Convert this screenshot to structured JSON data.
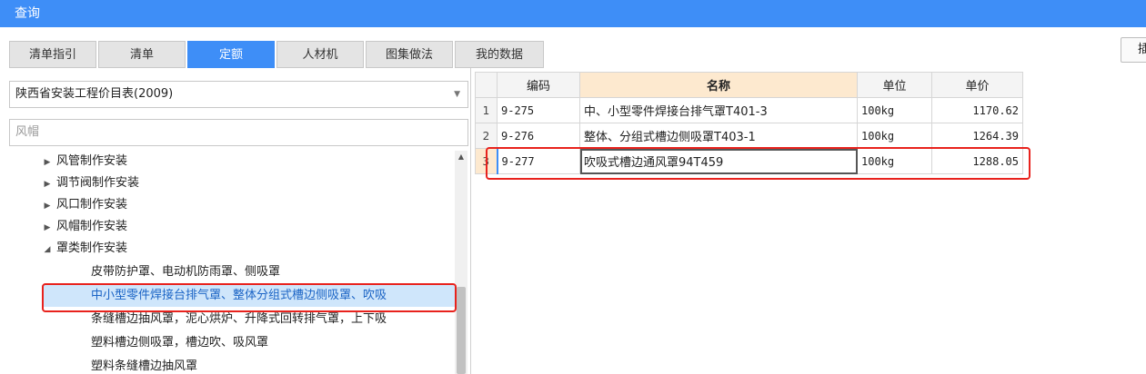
{
  "window": {
    "title": "查询"
  },
  "tabs": [
    {
      "label": "清单指引",
      "active": false
    },
    {
      "label": "清单",
      "active": false
    },
    {
      "label": "定额",
      "active": true
    },
    {
      "label": "人材机",
      "active": false
    },
    {
      "label": "图集做法",
      "active": false
    },
    {
      "label": "我的数据",
      "active": false
    }
  ],
  "right_button": {
    "label": "插"
  },
  "library_select": {
    "value": "陕西省安装工程价目表(2009)"
  },
  "search": {
    "value": "风帽"
  },
  "tree": [
    {
      "label": "风管制作安装",
      "expanded": false
    },
    {
      "label": "调节阀制作安装",
      "expanded": false
    },
    {
      "label": "风口制作安装",
      "expanded": false
    },
    {
      "label": "风帽制作安装",
      "expanded": false
    },
    {
      "label": "罩类制作安装",
      "expanded": true
    },
    {
      "label": "皮带防护罩、电动机防雨罩、侧吸罩"
    },
    {
      "label": "中小型零件焊接台排气罩、整体分组式槽边侧吸罩、吹吸",
      "selected": true
    },
    {
      "label": "条缝槽边抽风罩，泥心烘炉、升降式回转排气罩，上下吸"
    },
    {
      "label": "塑料槽边侧吸罩，槽边吹、吸风罩"
    },
    {
      "label": "塑料条缝槽边抽风罩"
    }
  ],
  "grid": {
    "headers": {
      "code": "编码",
      "name": "名称",
      "unit": "单位",
      "price": "单价"
    },
    "rows": [
      {
        "num": "1",
        "code": "9-275",
        "name": "中、小型零件焊接台排气罩T401-3",
        "unit": "100kg",
        "price": "1170.62"
      },
      {
        "num": "2",
        "code": "9-276",
        "name": "整体、分组式槽边侧吸罩T403-1",
        "unit": "100kg",
        "price": "1264.39"
      },
      {
        "num": "3",
        "code": "9-277",
        "name": "吹吸式槽边通风罩94T459",
        "unit": "100kg",
        "price": "1288.05"
      }
    ]
  },
  "colors": {
    "accent": "#3e8ef7",
    "highlight": "#e8221d",
    "selected_bg": "#cfe6fb",
    "header_name_bg": "#fde9cf"
  }
}
